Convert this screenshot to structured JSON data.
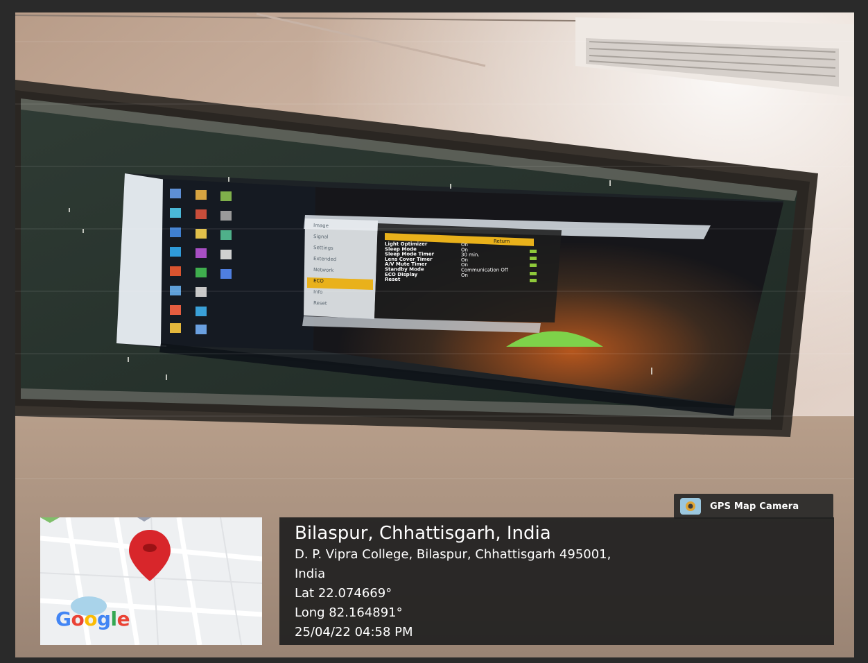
{
  "badge": {
    "label": "GPS Map Camera",
    "icon": "gps-map-camera-icon"
  },
  "map": {
    "brand": "Google",
    "pin_icon": "location-pin-icon",
    "pin_color": "#d8262b"
  },
  "location": {
    "title": "Bilaspur, Chhattisgarh, India",
    "address_line1": "D. P. Vipra College, Bilaspur, Chhattisgarh 495001,",
    "address_line2": "India",
    "latitude": "Lat 22.074669°",
    "longitude": "Long 82.164891°",
    "timestamp": "25/04/22 04:58 PM"
  },
  "projector_menu": {
    "tabs": [
      "Image",
      "Signal",
      "Settings",
      "Extended",
      "Network",
      "ECO",
      "Info",
      "Reset"
    ],
    "selected_tab": "ECO",
    "header": "Return",
    "rows": [
      {
        "label": "Light Optimizer",
        "value": "On"
      },
      {
        "label": "Sleep Mode",
        "value": "On"
      },
      {
        "label": "Sleep Mode Timer",
        "value": "30 min."
      },
      {
        "label": "Lens Cover Timer",
        "value": "On"
      },
      {
        "label": "A/V Mute Timer",
        "value": "On"
      },
      {
        "label": "Standby Mode",
        "value": "Communication Off"
      },
      {
        "label": "ECO Display",
        "value": "On"
      },
      {
        "label": "Reset",
        "value": ""
      }
    ]
  }
}
